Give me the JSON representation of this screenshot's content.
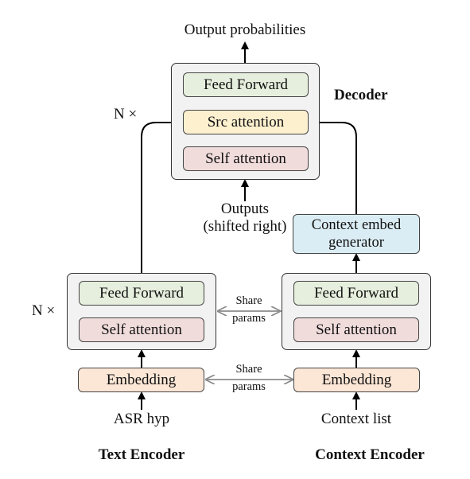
{
  "decoder": {
    "title": "Decoder",
    "repeat": "N ×",
    "output_label": "Output probabilities",
    "input_label_line1": "Outputs",
    "input_label_line2": "(shifted right)",
    "layers": [
      "Feed Forward",
      "Src attention",
      "Self attention"
    ]
  },
  "context_embed_generator": {
    "line1": "Context embed",
    "line2": "generator"
  },
  "text_encoder": {
    "title": "Text Encoder",
    "repeat": "N ×",
    "layers": [
      "Feed Forward",
      "Self attention"
    ],
    "embedding": "Embedding",
    "input_label": "ASR hyp"
  },
  "context_encoder": {
    "title": "Context Encoder",
    "layers": [
      "Feed Forward",
      "Self attention"
    ],
    "embedding": "Embedding",
    "input_label": "Context list"
  },
  "share_params": {
    "line1": "Share",
    "line2": "params"
  },
  "colors": {
    "feed_forward": "#e6efdd",
    "self_attention": "#f1dcdc",
    "src_attention": "#fdf0cf",
    "embedding": "#fce6d6",
    "context_embed": "#dbedf4",
    "container": "#f2f2f2",
    "share_arrow": "#8c8c8c"
  }
}
